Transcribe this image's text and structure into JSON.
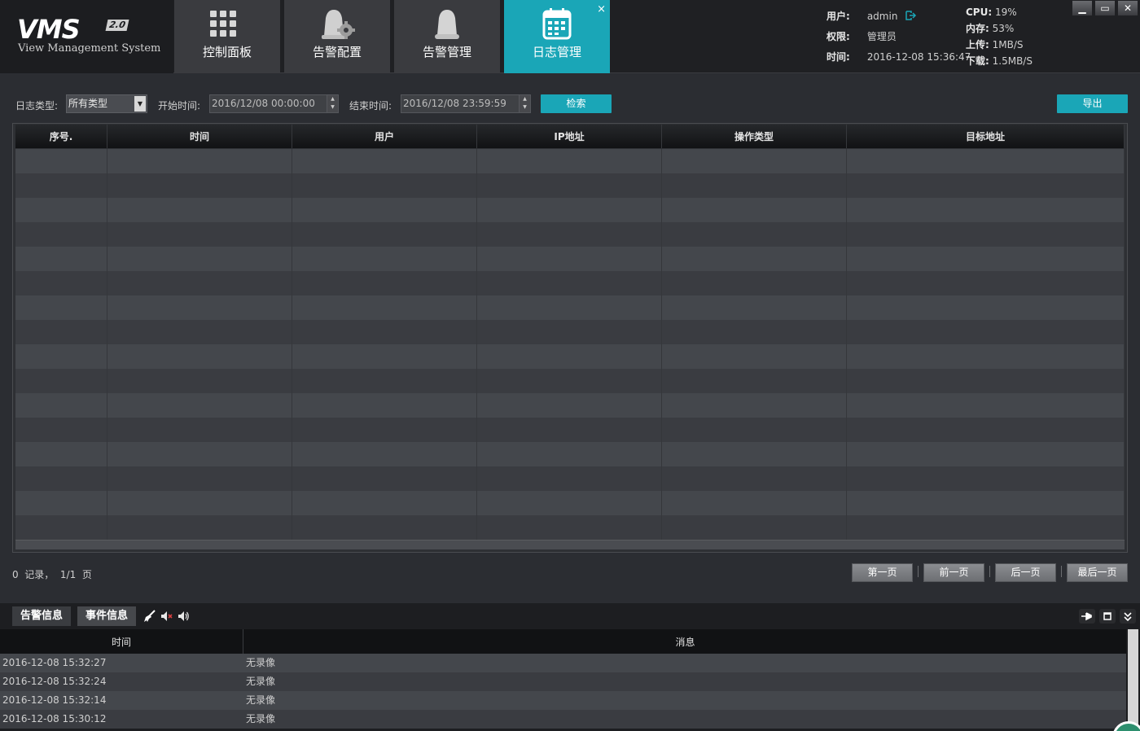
{
  "header": {
    "logo": {
      "name": "VMS",
      "version": "2.0",
      "subtitle": "View Management System"
    },
    "tabs": [
      {
        "label": "控制面板",
        "icon": "grid-icon"
      },
      {
        "label": "告警配置",
        "icon": "alarm-gear-icon"
      },
      {
        "label": "告警管理",
        "icon": "alarm-bell-icon"
      },
      {
        "label": "日志管理",
        "icon": "calendar-icon",
        "active": true,
        "close": "×"
      }
    ],
    "user_label": "用户:",
    "user_value": "admin",
    "role_label": "权限:",
    "role_value": "管理员",
    "time_label": "时间:",
    "time_value": "2016-12-08 15:36:47",
    "cpu_label": "CPU:",
    "cpu_value": "19%",
    "mem_label": "内存:",
    "mem_value": "53%",
    "up_label": "上传:",
    "up_value": "1MB/S",
    "down_label": "下载:",
    "down_value": "1.5MB/S",
    "window": {
      "minimize": "▁",
      "maximize": "▭",
      "close": "✕"
    }
  },
  "filter": {
    "type_label": "日志类型:",
    "type_value": "所有类型",
    "start_label": "开始时间:",
    "start_value": "2016/12/08 00:00:00",
    "end_label": "结束时间:",
    "end_value": "2016/12/08 23:59:59",
    "search_label": "检索",
    "export_label": "导出"
  },
  "log_table": {
    "columns": [
      "序号.",
      "时间",
      "用户",
      "IP地址",
      "操作类型",
      "目标地址"
    ],
    "rows": []
  },
  "pager": {
    "summary": "0  记录，  1/1  页",
    "first": "第一页",
    "prev": "前一页",
    "next": "后一页",
    "last": "最后一页"
  },
  "events": {
    "tabs": [
      "告警信息",
      "事件信息"
    ],
    "columns": [
      "时间",
      "消息"
    ],
    "rows": [
      {
        "time": "2016-12-08 15:32:27",
        "message": "无录像"
      },
      {
        "time": "2016-12-08 15:32:24",
        "message": "无录像"
      },
      {
        "time": "2016-12-08 15:32:14",
        "message": "无录像"
      },
      {
        "time": "2016-12-08 15:30:12",
        "message": "无录像"
      }
    ]
  },
  "colors": {
    "accent": "#1aa6b7",
    "row_a": "#44474c",
    "row_b": "#3a3c41"
  }
}
